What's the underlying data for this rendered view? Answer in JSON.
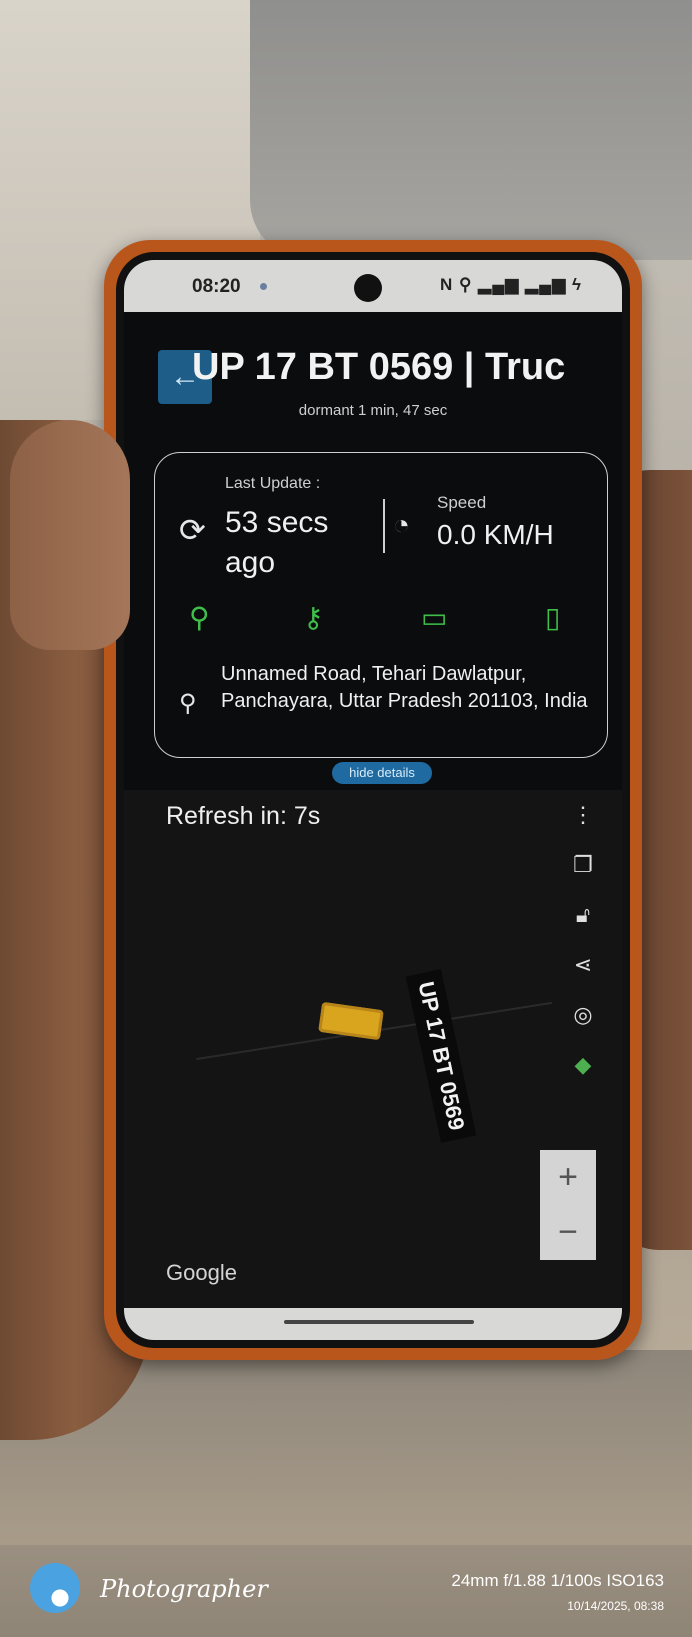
{
  "status_bar": {
    "time": "08:20",
    "icons": "N ⚲ ▂▄▆ ▂▄▆ ϟ"
  },
  "header": {
    "title": "UP 17 BT 0569 | Truc",
    "subtitle": "dormant 1 min, 47 sec",
    "back_icon": "←"
  },
  "details": {
    "last_update_label": "Last Update :",
    "last_update_value": "53 secs ago",
    "speed_label": "Speed",
    "speed_value": "0.0 KM/H",
    "address": "Unnamed Road, Tehari Dawlatpur, Panchayara, Uttar Pradesh 201103, India",
    "hide_label": "hide details",
    "status_icons": [
      "location-pin-icon",
      "key-icon",
      "battery-icon",
      "charging-battery-icon"
    ],
    "accent_color": "#3fbf4a"
  },
  "map": {
    "refresh_text": "Refresh in: 7s",
    "vehicle_label": "UP 17 BT 0569",
    "attribution": "Google",
    "zoom_in": "+",
    "zoom_out": "−",
    "side_icons": [
      "more-icon",
      "layers-icon",
      "lock-icon",
      "share-icon",
      "locate-icon",
      "google-maps-icon"
    ]
  },
  "watermark": {
    "brand": "Photographer",
    "specs": "24mm  f/1.88  1/100s  ISO163",
    "date": "10/14/2025, 08:38"
  }
}
